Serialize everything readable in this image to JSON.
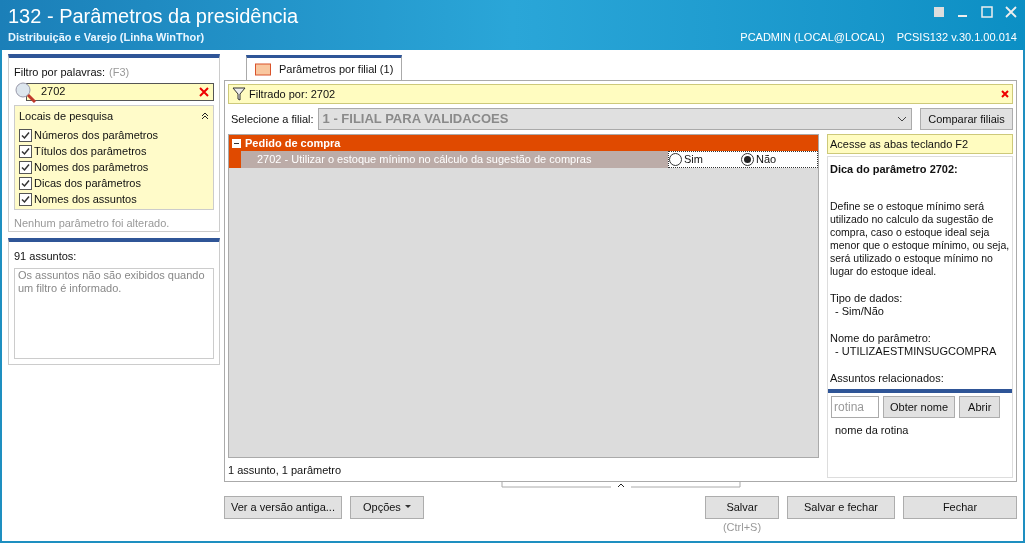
{
  "window": {
    "title": "132 - Parâmetros da presidência",
    "subtitle": "Distribuição e Varejo (Linha WinThor)",
    "user": "PCADMIN (LOCAL@LOCAL)",
    "version": "PCSIS132  v.30.1.00.014"
  },
  "filter": {
    "label": "Filtro por palavras:",
    "shortcut": "(F3)",
    "value": "2702",
    "locations_title": "Locais de pesquisa",
    "locations": [
      {
        "label": "Números dos parâmetros",
        "checked": true
      },
      {
        "label": "Títulos dos parâmetros",
        "checked": true
      },
      {
        "label": "Nomes dos parâmetros",
        "checked": true
      },
      {
        "label": "Dicas dos parâmetros",
        "checked": true
      },
      {
        "label": "Nomes dos assuntos",
        "checked": true
      }
    ],
    "status": "Nenhum parâmetro foi alterado."
  },
  "subjects": {
    "label": "91 assuntos:",
    "message": "Os assuntos não são exibidos quando um filtro é informado."
  },
  "tabs": [
    {
      "label": "Parâmetros por filial  (1)",
      "selected": true
    }
  ],
  "filtered_by": "Filtrado por: 2702",
  "branch": {
    "label": "Selecione a filial:",
    "value": "1 - FILIAL PARA VALIDACOES",
    "disabled": true
  },
  "compare_button": "Comparar filiais",
  "groups": [
    {
      "title": "Pedido de compra",
      "expanded": true,
      "params": [
        {
          "label": "2702 - Utilizar o estoque mínimo no cálculo da sugestão de compras",
          "options": [
            {
              "label": "Sim",
              "selected": false
            },
            {
              "label": "Não",
              "selected": true
            }
          ]
        }
      ]
    }
  ],
  "summary": "1 assunto, 1 parâmetro",
  "hint_bar": "Acesse as abas teclando F2",
  "tip": {
    "title": "Dica do parâmetro 2702:",
    "body": "Define se o estoque mínimo será utilizado no calculo da sugestão de compra, caso o estoque ideal seja menor que o estoque mínimo, ou seja, será utilizado o estoque mínimo no lugar do estoque ideal.",
    "sections": [
      {
        "heading": "Tipo de dados:",
        "value": "- Sim/Não"
      },
      {
        "heading": "Nome do parâmetro:",
        "value": "- UTILIZAESTMINSUGCOMPRA"
      },
      {
        "heading": "Assuntos relacionados:"
      }
    ]
  },
  "routine": {
    "placeholder": "rotina",
    "get_name": "Obter nome",
    "open": "Abrir",
    "name": "nome da rotina"
  },
  "buttons": {
    "old_version": "Ver a versão antiga...",
    "options": "Opções",
    "save": "Salvar",
    "save_shortcut": "(Ctrl+S)",
    "save_close": "Salvar e fechar",
    "close": "Fechar"
  }
}
